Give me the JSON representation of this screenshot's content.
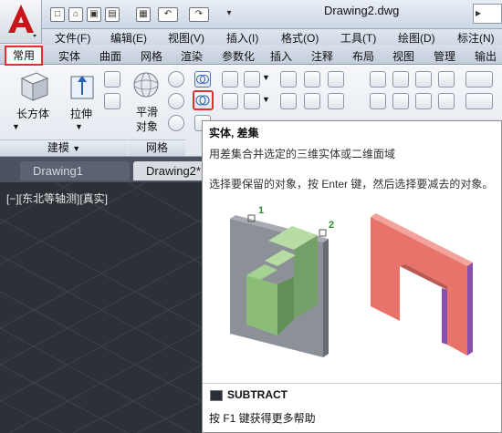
{
  "window": {
    "title": "Drawing2.dwg"
  },
  "menu": [
    "文件(F)",
    "编辑(E)",
    "视图(V)",
    "插入(I)",
    "格式(O)",
    "工具(T)",
    "绘图(D)",
    "标注(N)"
  ],
  "tabs": [
    "常用",
    "实体",
    "曲面",
    "网格",
    "渲染",
    "参数化",
    "插入",
    "注释",
    "布局",
    "视图",
    "管理",
    "输出"
  ],
  "ribbon": {
    "box_label": "长方体",
    "extrude_label": "拉伸",
    "smooth_label_1": "平滑",
    "smooth_label_2": "对象",
    "panel_modeling": "建模",
    "panel_modeling_arrow": "▼",
    "panel_mesh": "网格"
  },
  "file_tabs": [
    "Drawing1",
    "Drawing2*"
  ],
  "viewport": {
    "label": "[−][东北等轴测][真实]"
  },
  "tooltip": {
    "title": "实体, 差集",
    "description": "用差集合并选定的三维实体或二维面域",
    "detail": "选择要保留的对象，按 Enter 键，然后选择要减去的对象。",
    "marker_1": "1",
    "marker_2": "2",
    "command": "SUBTRACT",
    "help": "按 F1 键获得更多帮助"
  },
  "colors": {
    "highlight": "#e03030",
    "viewport_bg": "#2c3138",
    "solid_green": "#7ab86a",
    "solid_gray": "#7c8088",
    "result_red": "#e8736b",
    "result_purple": "#8a4fa8"
  }
}
